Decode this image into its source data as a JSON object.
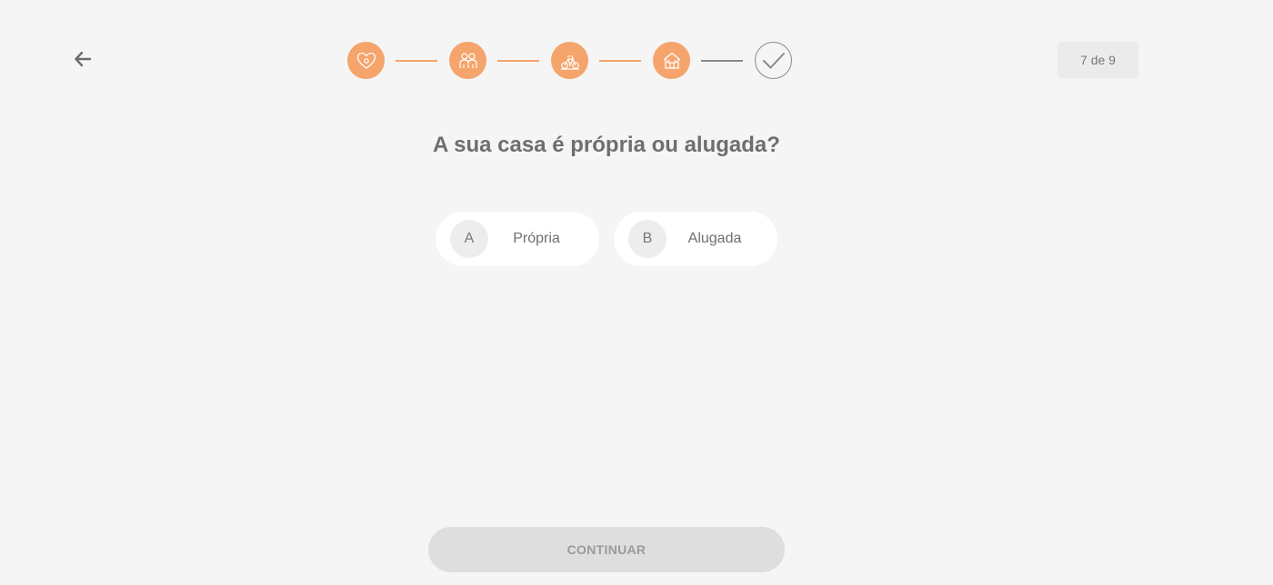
{
  "header": {
    "back_icon": "arrow-left-icon",
    "counter": "7 de 9"
  },
  "stepper": {
    "steps": [
      {
        "icon": "heart-icon",
        "state": "done"
      },
      {
        "icon": "family-icon",
        "state": "done"
      },
      {
        "icon": "bicycle-icon",
        "state": "done"
      },
      {
        "icon": "house-icon",
        "state": "done"
      },
      {
        "icon": "check-icon",
        "state": "pending"
      }
    ],
    "colors": {
      "done": "#f5a46b",
      "pending": "#8a8a8a"
    }
  },
  "question": {
    "text": "A sua casa é própria ou alugada?"
  },
  "options": [
    {
      "letter": "A",
      "label": "Própria"
    },
    {
      "letter": "B",
      "label": "Alugada"
    }
  ],
  "footer": {
    "continue_label": "CONTINUAR"
  }
}
